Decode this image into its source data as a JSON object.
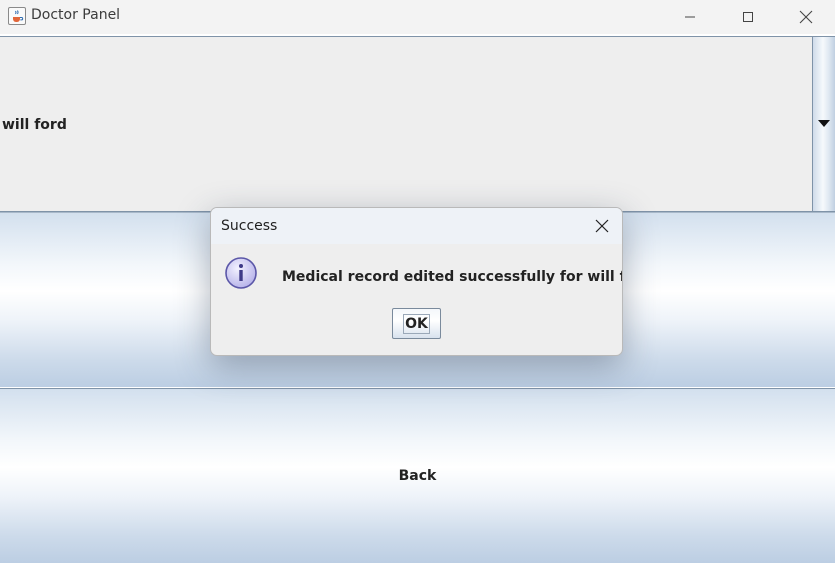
{
  "window": {
    "title": "Doctor Panel",
    "icon": "java-cup-icon"
  },
  "patient_combo": {
    "selected_value": "will ford",
    "arrow_icon": "triangle-down-icon"
  },
  "buttons": {
    "save_label": "",
    "back_label": "Back"
  },
  "dialog": {
    "title": "Success",
    "icon": "info-icon",
    "message": "Medical record edited successfully for will ford",
    "ok_label": "OK"
  },
  "colors": {
    "border_blue": "#7f93a8",
    "button_gradient_light": "#ffffff",
    "button_gradient_dark": "#bccee3",
    "info_icon_fill": "#c9c6f0",
    "info_icon_stroke": "#5b57a8"
  }
}
